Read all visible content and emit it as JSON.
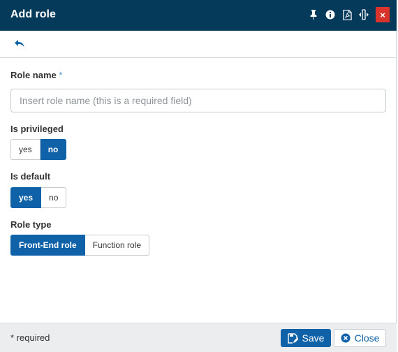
{
  "dialog": {
    "title": "Add role",
    "toolbar_icons": [
      "pin-icon",
      "info-icon",
      "pdf-icon",
      "resize-horizontal-icon",
      "close-icon"
    ],
    "close_glyph": "×"
  },
  "form": {
    "role_name": {
      "label": "Role name",
      "required_marker": "*",
      "placeholder": "Insert role name (this is a required field)",
      "value": ""
    },
    "is_privileged": {
      "label": "Is privileged",
      "options": [
        "yes",
        "no"
      ],
      "selected": "no"
    },
    "is_default": {
      "label": "Is default",
      "options": [
        "yes",
        "no"
      ],
      "selected": "yes"
    },
    "role_type": {
      "label": "Role type",
      "options": [
        "Front-End role",
        "Function role"
      ],
      "selected": "Front-End role"
    }
  },
  "footer": {
    "required_note": "* required",
    "save_label": "Save",
    "close_label": "Close"
  },
  "colors": {
    "titlebar": "#063a5b",
    "accent": "#0f62a8",
    "close_red": "#d9342b",
    "footer_bg": "#ebedef"
  }
}
